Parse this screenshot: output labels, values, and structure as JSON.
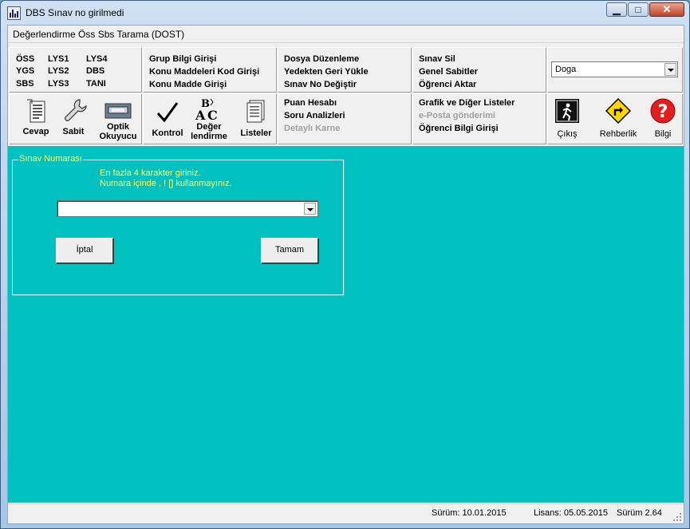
{
  "window": {
    "title": "DBS  Sınav no girilmedi",
    "minimize_glyph": "▁",
    "maximize_glyph": "□",
    "close_glyph": "✕"
  },
  "menubar": {
    "label": "Değerlendirme Öss Sbs Tarama (DOST)"
  },
  "exam_types": {
    "col1": [
      "ÖSS",
      "YGS",
      "SBS"
    ],
    "col2": [
      "LYS1",
      "LYS2",
      "LYS3"
    ],
    "col3": [
      "LYS4",
      "DBS",
      "TANI"
    ]
  },
  "toolbar_left_buttons": {
    "cevap": "Cevap",
    "sabit": "Sabit",
    "optik_1": "Optik",
    "optik_2": "Okuyucu"
  },
  "toolbar_mid_buttons": {
    "kontrol": "Kontrol",
    "deger_1": "Değer",
    "deger_2": "lendirme",
    "listeler": "Listeler"
  },
  "menu_group_1": [
    "Grup Bilgi Girişi",
    "Konu Maddeleri Kod Girişi",
    "Konu Madde Girişi"
  ],
  "menu_group_2": [
    "Dosya Düzenleme",
    "Yedekten Geri Yükle",
    "Sınav No Değiştir"
  ],
  "menu_group_3": [
    "Puan Hesabı",
    "Soru Analizleri",
    "Detaylı Karne"
  ],
  "menu_group_4": [
    "Sınav Sil",
    "Genel Sabitler",
    "Öğrenci Aktar"
  ],
  "menu_group_5": [
    "Grafik ve Diğer Listeler",
    "e-Posta gönderimi",
    "Öğrenci Bilgi Girişi"
  ],
  "profile_select": {
    "value": "Doga"
  },
  "right_buttons": {
    "cikis": "Çıkış",
    "rehberlik": "Rehberlik",
    "bilgi": "Bilgi"
  },
  "exam_panel": {
    "title": "Sınav Numarası",
    "hint_1": "En fazla 4 karakter giriniz.",
    "hint_2": "Numara içinde , ! [] kullanmayınız.",
    "combo_value": "",
    "cancel_label": "İptal",
    "ok_label": "Tamam"
  },
  "statusbar": {
    "surum_date": "Sürüm: 10.01.2015",
    "lisans": "Lisans: 05.05.2015",
    "surum": "Sürüm 2.64"
  },
  "colors": {
    "main_bg": "#00c0c0",
    "hint_text": "#ffff66",
    "disabled_text": "#a0a0a0"
  }
}
